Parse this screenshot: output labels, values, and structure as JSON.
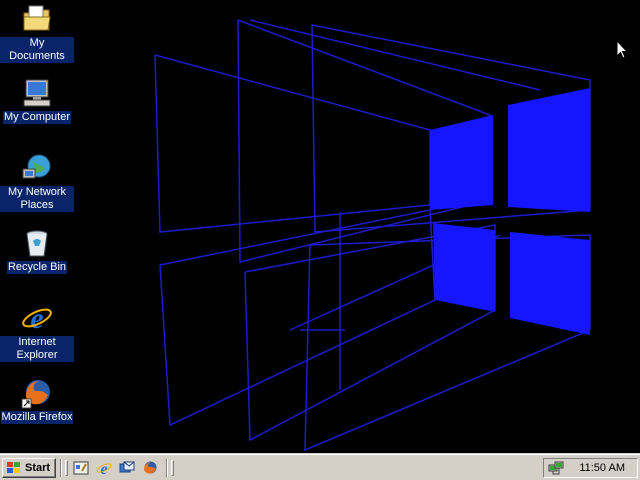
{
  "desktop": {
    "icons": [
      {
        "label": "My Documents",
        "icon": "folder-documents-icon"
      },
      {
        "label": "My Computer",
        "icon": "computer-icon"
      },
      {
        "label": "My Network Places",
        "icon": "network-places-icon"
      },
      {
        "label": "Recycle Bin",
        "icon": "recycle-bin-icon"
      },
      {
        "label": "Internet Explorer",
        "icon": "internet-explorer-icon"
      },
      {
        "label": "Mozilla Firefox",
        "icon": "firefox-icon"
      }
    ],
    "wallpaper_color": "#1a1aff"
  },
  "taskbar": {
    "start_label": "Start",
    "quick_launch": [
      {
        "icon": "show-desktop-icon"
      },
      {
        "icon": "internet-explorer-icon"
      },
      {
        "icon": "outlook-express-icon"
      },
      {
        "icon": "firefox-icon"
      }
    ],
    "tray": {
      "icon": "network-tray-icon",
      "clock": "11:50 AM"
    }
  },
  "colors": {
    "taskbar_bg": "#d4d0c8",
    "selection_bg": "#0a246a",
    "wallpaper_blue": "#1a1aff"
  }
}
